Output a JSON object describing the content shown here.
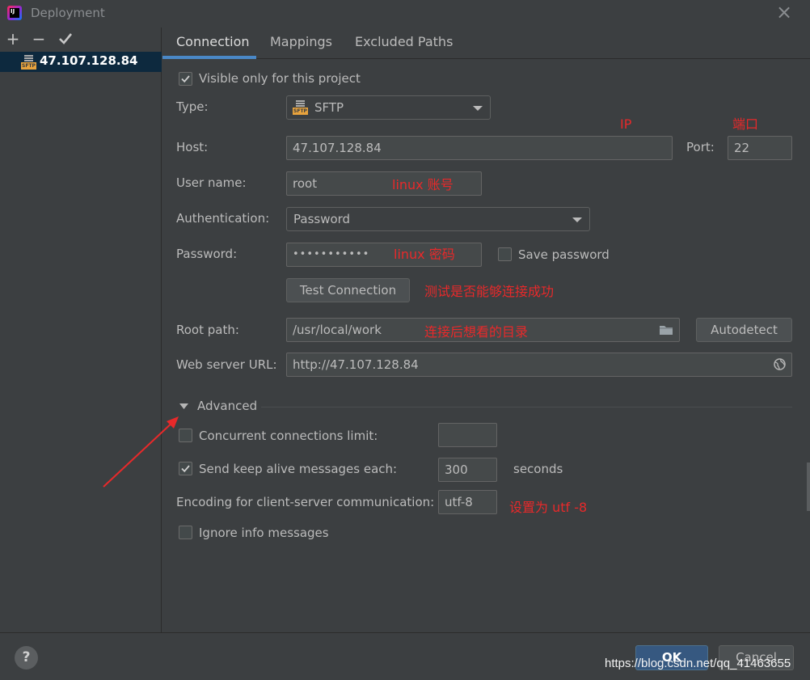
{
  "window": {
    "title": "Deployment",
    "close_icon": "close-icon",
    "app_icon_text": "IJ"
  },
  "toolbar": {
    "add_icon": "+",
    "remove_icon": "−",
    "apply_icon": "check-icon"
  },
  "servers": [
    {
      "name": "47.107.128.84",
      "icon": "sftp-icon",
      "icon_text": "SFTP"
    }
  ],
  "tabs": [
    {
      "label": "Connection",
      "active": true
    },
    {
      "label": "Mappings",
      "active": false
    },
    {
      "label": "Excluded Paths",
      "active": false
    }
  ],
  "connection": {
    "visible_only": {
      "label": "Visible only for this project",
      "checked": true
    },
    "type": {
      "label": "Type:",
      "value": "SFTP"
    },
    "host": {
      "label": "Host:",
      "value": "47.107.128.84"
    },
    "port": {
      "label": "Port:",
      "value": "22"
    },
    "username": {
      "label": "User name:",
      "value": "root"
    },
    "auth": {
      "label": "Authentication:",
      "value": "Password"
    },
    "password": {
      "label": "Password:",
      "value": "•••••••••••"
    },
    "save_password": {
      "label": "Save password",
      "checked": false
    },
    "test_button": "Test Connection",
    "root_path": {
      "label": "Root path:",
      "value": "/usr/local/work"
    },
    "autodetect_button": "Autodetect",
    "web_url": {
      "label": "Web server URL:",
      "value": "http://47.107.128.84"
    }
  },
  "advanced": {
    "title": "Advanced",
    "concurrent": {
      "label": "Concurrent connections limit:",
      "checked": false,
      "value": ""
    },
    "keep_alive": {
      "label": "Send keep alive messages each:",
      "checked": true,
      "value": "300",
      "unit": "seconds"
    },
    "encoding": {
      "label": "Encoding for client-server communication:",
      "value": "utf-8"
    },
    "ignore_info": {
      "label": "Ignore info messages",
      "checked": false
    }
  },
  "annotations": {
    "ip": "IP",
    "port": "端口",
    "username": "linux 账号",
    "password": "linux 密码",
    "test": "测试是否能够连接成功",
    "root": "连接后想看的目录",
    "encoding": "设置为 utf -8"
  },
  "footer": {
    "help": "?",
    "ok": "OK",
    "cancel": "Cancel"
  },
  "watermark": "https://blog.csdn.net/qq_41463655",
  "colors": {
    "accent": "#4a88c7",
    "annotation": "#e8292a",
    "background": "#3c3f41",
    "ok_button": "#365880"
  }
}
